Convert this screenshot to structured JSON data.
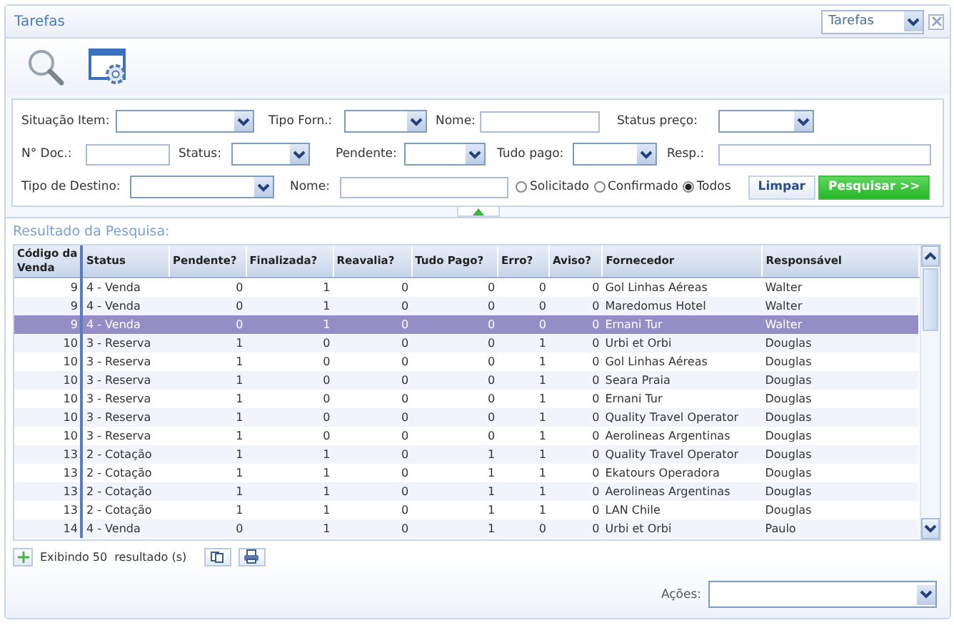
{
  "window": {
    "title": "Tarefas"
  },
  "view_select": {
    "value": "Tarefas"
  },
  "filters": [
    [
      {
        "label": "Situação Item:",
        "kind": "select"
      },
      {
        "label": "Tipo Forn.:",
        "kind": "select"
      },
      {
        "label": "Nome:",
        "kind": "input"
      },
      {
        "label": "Status preço:",
        "kind": "select"
      }
    ],
    [
      {
        "label": "N° Doc.:",
        "kind": "input"
      },
      {
        "label": "Status:",
        "kind": "select"
      },
      {
        "label": "Pendente:",
        "kind": "select"
      },
      {
        "label": "Tudo pago:",
        "kind": "select"
      },
      {
        "label": "Resp.:",
        "kind": "input"
      }
    ],
    [
      {
        "label": "Tipo de Destino:",
        "kind": "select"
      },
      {
        "label": "Nome:",
        "kind": "input"
      }
    ]
  ],
  "radios": [
    {
      "label": "Solicitado",
      "selected": false
    },
    {
      "label": "Confirmado",
      "selected": false
    },
    {
      "label": "Todos",
      "selected": true
    }
  ],
  "buttons": [
    {
      "label": "Limpar",
      "kind": "secondary"
    },
    {
      "label": "Pesquisar >>",
      "kind": "primary"
    }
  ],
  "results": {
    "title": "Resultado da Pesquisa:",
    "columns": [
      "Código da Venda",
      "Status",
      "Pendente?",
      "Finalizada?",
      "Reavalia?",
      "Tudo Pago?",
      "Erro?",
      "Aviso?",
      "Fornecedor",
      "Responsável"
    ],
    "rows": [
      {
        "selected": false,
        "cells": [
          "9",
          "4 - Venda",
          "0",
          "1",
          "0",
          "0",
          "0",
          "0",
          "Gol Linhas Aéreas",
          "Walter"
        ]
      },
      {
        "selected": false,
        "cells": [
          "9",
          "4 - Venda",
          "0",
          "1",
          "0",
          "0",
          "0",
          "0",
          "Maredomus Hotel",
          "Walter"
        ]
      },
      {
        "selected": true,
        "cells": [
          "9",
          "4 - Venda",
          "0",
          "1",
          "0",
          "0",
          "0",
          "0",
          "Ernani Tur",
          "Walter"
        ]
      },
      {
        "selected": false,
        "cells": [
          "10",
          "3 - Reserva",
          "1",
          "0",
          "0",
          "0",
          "1",
          "0",
          "Urbi et Orbi",
          "Douglas"
        ]
      },
      {
        "selected": false,
        "cells": [
          "10",
          "3 - Reserva",
          "1",
          "0",
          "0",
          "0",
          "1",
          "0",
          "Gol Linhas Aéreas",
          "Douglas"
        ]
      },
      {
        "selected": false,
        "cells": [
          "10",
          "3 - Reserva",
          "1",
          "0",
          "0",
          "0",
          "1",
          "0",
          "Seara Praia",
          "Douglas"
        ]
      },
      {
        "selected": false,
        "cells": [
          "10",
          "3 - Reserva",
          "1",
          "0",
          "0",
          "0",
          "1",
          "0",
          "Ernani Tur",
          "Douglas"
        ]
      },
      {
        "selected": false,
        "cells": [
          "10",
          "3 - Reserva",
          "1",
          "0",
          "0",
          "0",
          "1",
          "0",
          "Quality Travel Operator",
          "Douglas"
        ]
      },
      {
        "selected": false,
        "cells": [
          "10",
          "3 - Reserva",
          "1",
          "0",
          "0",
          "0",
          "1",
          "0",
          "Aerolineas Argentinas",
          "Douglas"
        ]
      },
      {
        "selected": false,
        "cells": [
          "13",
          "2 - Cotação",
          "1",
          "1",
          "0",
          "1",
          "1",
          "0",
          "Quality Travel Operator",
          "Douglas"
        ]
      },
      {
        "selected": false,
        "cells": [
          "13",
          "2 - Cotação",
          "1",
          "1",
          "0",
          "1",
          "1",
          "0",
          "Ekatours Operadora",
          "Douglas"
        ]
      },
      {
        "selected": false,
        "cells": [
          "13",
          "2 - Cotação",
          "1",
          "1",
          "0",
          "1",
          "1",
          "0",
          "Aerolineas Argentinas",
          "Douglas"
        ]
      },
      {
        "selected": false,
        "cells": [
          "13",
          "2 - Cotação",
          "1",
          "1",
          "0",
          "1",
          "1",
          "0",
          "LAN Chile",
          "Douglas"
        ]
      },
      {
        "selected": false,
        "cells": [
          "14",
          "4 - Venda",
          "0",
          "1",
          "0",
          "1",
          "0",
          "0",
          "Urbi et Orbi",
          "Paulo"
        ]
      }
    ],
    "count_text": "Exibindo 50  resultado (s)"
  },
  "actions": {
    "label": "Ações:"
  }
}
